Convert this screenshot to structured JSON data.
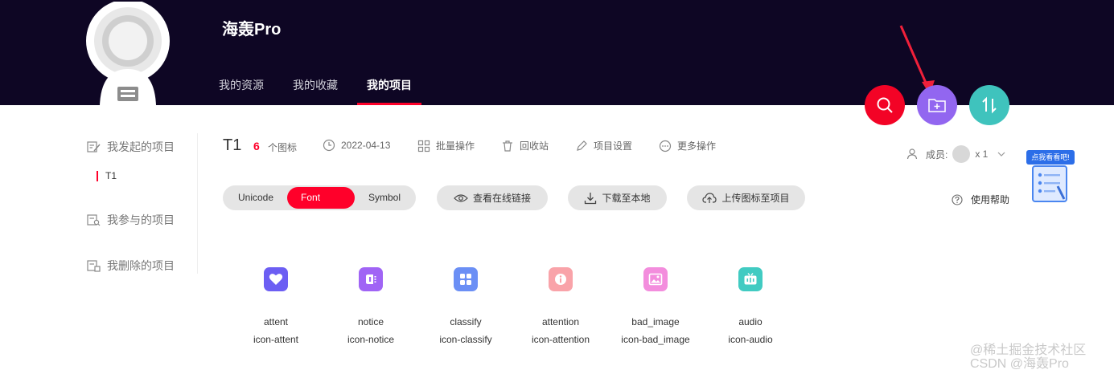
{
  "header": {
    "brand": "海轰Pro",
    "nav": [
      {
        "label": "我的资源"
      },
      {
        "label": "我的收藏"
      },
      {
        "label": "我的项目",
        "active": true
      }
    ]
  },
  "fabs": {
    "search": "search-icon",
    "add_folder": "folder-plus-icon",
    "sort": "sort-icon"
  },
  "sidebar": {
    "initiated": "我发起的项目",
    "sub_item": "T1",
    "participated": "我参与的项目",
    "deleted": "我删除的项目"
  },
  "project": {
    "title": "T1",
    "count": "6",
    "count_label": "个图标",
    "date": "2022-04-13",
    "batch": "批量操作",
    "recycle": "回收站",
    "settings": "项目设置",
    "more": "更多操作"
  },
  "members": {
    "label": "成员:",
    "count": "x 1"
  },
  "help": "使用帮助",
  "tabs": [
    {
      "label": "Unicode"
    },
    {
      "label": "Font class",
      "active": true
    },
    {
      "label": "Symbol"
    }
  ],
  "actions": {
    "view_link": "查看在线链接",
    "download": "下载至本地",
    "upload": "上传图标至项目"
  },
  "icons": [
    {
      "name": "attent",
      "class": "icon-attent",
      "color": "#6c5ef3"
    },
    {
      "name": "notice",
      "class": "icon-notice",
      "color": "#a064f5"
    },
    {
      "name": "classify",
      "class": "icon-classify",
      "color": "#6b8ff5"
    },
    {
      "name": "attention",
      "class": "icon-attention",
      "color": "#f9a3a9"
    },
    {
      "name": "bad_image",
      "class": "icon-bad_image",
      "color": "#f38ddd"
    },
    {
      "name": "audio",
      "class": "icon-audio",
      "color": "#41cbc2"
    }
  ],
  "float_widget": {
    "badge": "点我看看吧!"
  },
  "watermark": {
    "line1": "@稀土掘金技术社区",
    "line2": "CSDN @海轰Pro"
  },
  "colors": {
    "header_bg": "#0e0624",
    "accent": "#ff002a",
    "fab_search": "#f30326",
    "fab_folder": "#9266f0",
    "fab_sort": "#3fc3bd"
  }
}
